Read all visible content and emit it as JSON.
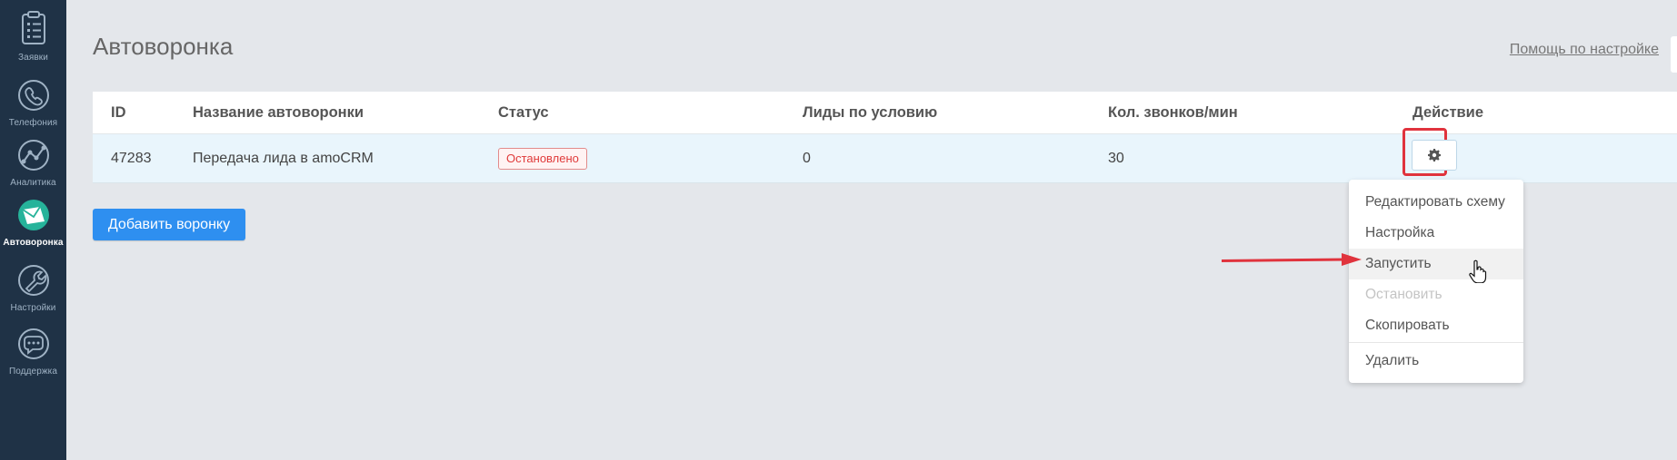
{
  "sidebar": {
    "items": [
      {
        "label": "Заявки",
        "icon": "clipboard-icon",
        "active": false
      },
      {
        "label": "Телефония",
        "icon": "phone-icon",
        "active": false
      },
      {
        "label": "Аналитика",
        "icon": "analytics-icon",
        "active": false
      },
      {
        "label": "Автоворонка",
        "icon": "envelope-icon",
        "active": true
      },
      {
        "label": "Настройки",
        "icon": "wrench-icon",
        "active": false
      },
      {
        "label": "Поддержка",
        "icon": "chat-bubble-icon",
        "active": false
      }
    ]
  },
  "page": {
    "title": "Автоворонка",
    "help_link": "Помощь по настройке"
  },
  "table": {
    "columns": [
      "ID",
      "Название автоворонки",
      "Статус",
      "Лиды по условию",
      "Кол. звонков/мин",
      "Действие"
    ],
    "rows": [
      {
        "id": "47283",
        "name": "Передача лида в amoCRM",
        "status": "Остановлено",
        "leads": "0",
        "calls": "30"
      }
    ]
  },
  "add_button": "Добавить воронку",
  "dropdown": {
    "items": [
      {
        "label": "Редактировать схему",
        "state": "normal"
      },
      {
        "label": "Настройка",
        "state": "normal"
      },
      {
        "label": "Запустить",
        "state": "hover"
      },
      {
        "label": "Остановить",
        "state": "disabled"
      },
      {
        "label": "Скопировать",
        "state": "normal"
      },
      {
        "label": "Удалить",
        "state": "normal"
      }
    ]
  },
  "colors": {
    "sidebar": "#1f3246",
    "accent": "#2e8ff0",
    "highlight": "#e0333d",
    "status_stopped": "#e03a3a"
  }
}
